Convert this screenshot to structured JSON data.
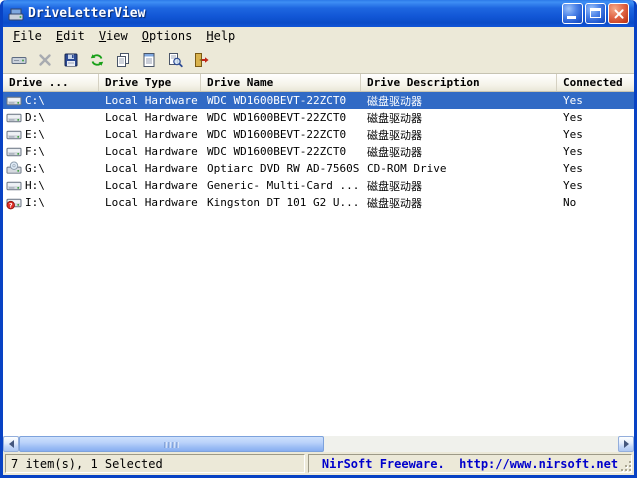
{
  "window": {
    "title": "DriveLetterView",
    "colors": {
      "titlebar_blue": "#1257D6",
      "selection_blue": "#316AC5",
      "link_blue": "#0000CC",
      "window_face": "#ECE9D8"
    }
  },
  "menu": {
    "items": [
      {
        "label": "File",
        "accel": "F",
        "rest": "ile"
      },
      {
        "label": "Edit",
        "accel": "E",
        "rest": "dit"
      },
      {
        "label": "View",
        "accel": "V",
        "rest": "iew"
      },
      {
        "label": "Options",
        "accel": "O",
        "rest": "ptions"
      },
      {
        "label": "Help",
        "accel": "H",
        "rest": "elp"
      }
    ]
  },
  "toolbar": {
    "buttons": [
      {
        "icon": "change-drive-letter-icon"
      },
      {
        "icon": "delete-x-icon",
        "disabled": true
      },
      {
        "icon": "save-icon"
      },
      {
        "icon": "refresh-icon"
      },
      {
        "icon": "copy-icon"
      },
      {
        "icon": "properties-icon"
      },
      {
        "icon": "find-icon"
      },
      {
        "icon": "exit-icon"
      }
    ]
  },
  "table": {
    "columns": [
      {
        "label": "Drive ..."
      },
      {
        "label": "Drive Type"
      },
      {
        "label": "Drive Name"
      },
      {
        "label": "Drive Description"
      },
      {
        "label": "Connected"
      }
    ],
    "rows": [
      {
        "icon": "hard-drive-icon",
        "drive": "C:\\",
        "type": "Local Hardware",
        "name": "WDC WD1600BEVT-22ZCT0",
        "description": "磁盘驱动器",
        "connected": "Yes",
        "selected": true
      },
      {
        "icon": "hard-drive-icon",
        "drive": "D:\\",
        "type": "Local Hardware",
        "name": "WDC WD1600BEVT-22ZCT0",
        "description": "磁盘驱动器",
        "connected": "Yes",
        "selected": false
      },
      {
        "icon": "hard-drive-icon",
        "drive": "E:\\",
        "type": "Local Hardware",
        "name": "WDC WD1600BEVT-22ZCT0",
        "description": "磁盘驱动器",
        "connected": "Yes",
        "selected": false
      },
      {
        "icon": "hard-drive-icon",
        "drive": "F:\\",
        "type": "Local Hardware",
        "name": "WDC WD1600BEVT-22ZCT0",
        "description": "磁盘驱动器",
        "connected": "Yes",
        "selected": false
      },
      {
        "icon": "cdrom-drive-icon",
        "drive": "G:\\",
        "type": "Local Hardware",
        "name": "Optiarc DVD RW AD-7560S",
        "description": "CD-ROM Drive",
        "connected": "Yes",
        "selected": false
      },
      {
        "icon": "card-reader-icon",
        "drive": "H:\\",
        "type": "Local Hardware",
        "name": "Generic- Multi-Card ...",
        "description": "磁盘驱动器",
        "connected": "Yes",
        "selected": false
      },
      {
        "icon": "disconnected-drive-icon",
        "drive": "I:\\",
        "type": "Local Hardware",
        "name": "Kingston DT 101 G2 U...",
        "description": "磁盘驱动器",
        "connected": "No",
        "selected": false
      }
    ]
  },
  "statusbar": {
    "left": "7 item(s), 1 Selected",
    "right": "NirSoft Freeware.  http://www.nirsoft.net"
  }
}
